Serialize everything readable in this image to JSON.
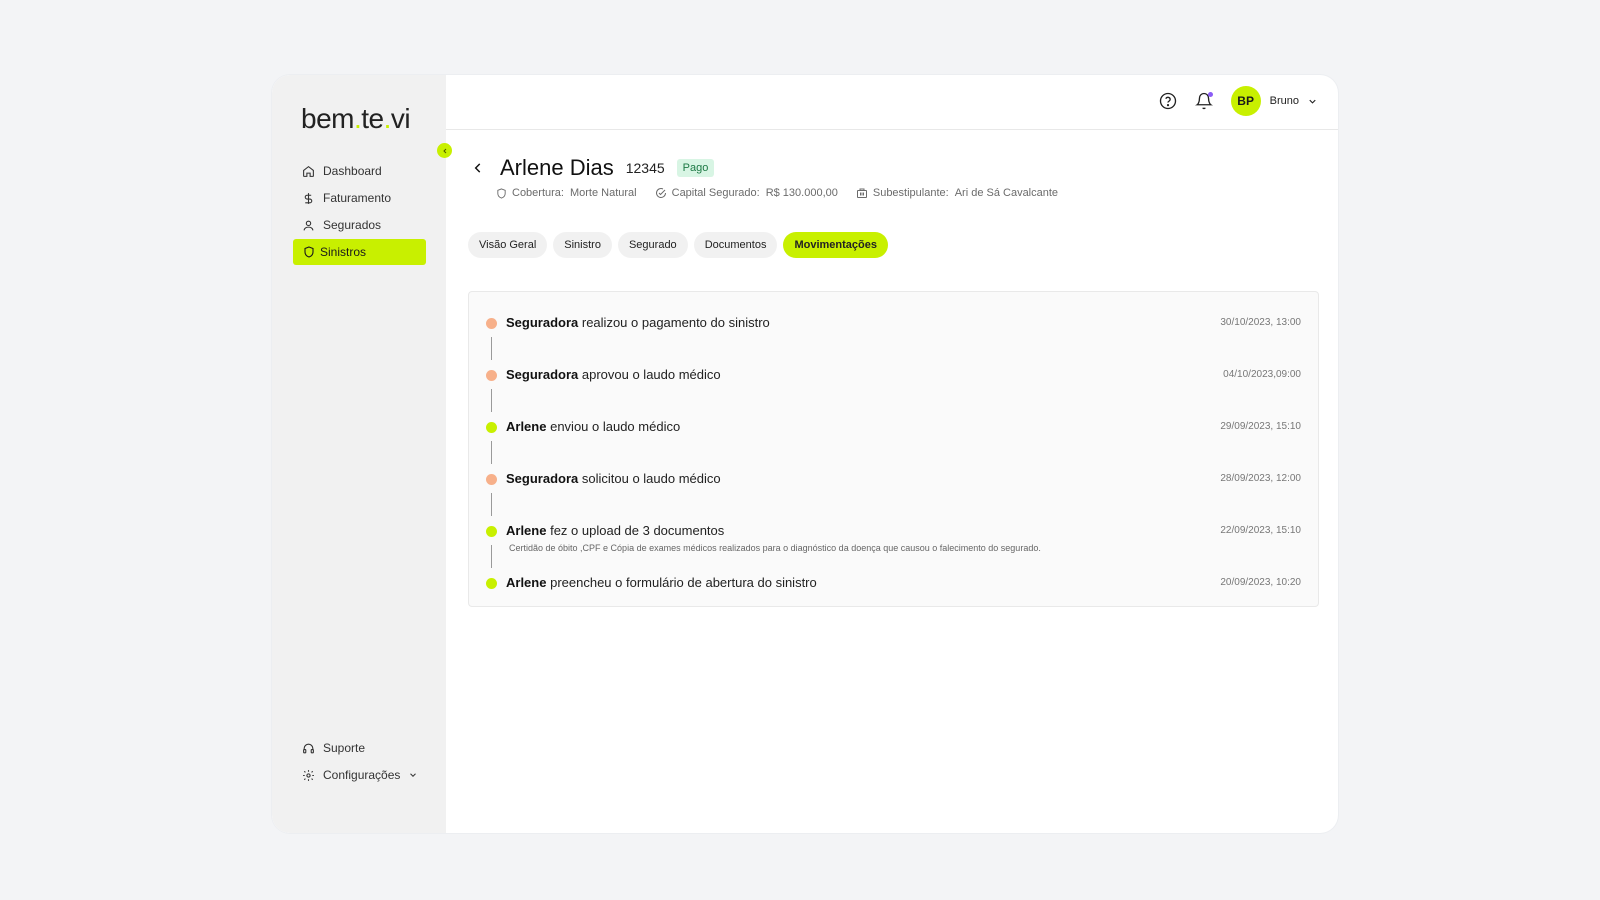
{
  "colors": {
    "accent": "#c8f000",
    "status_insurer": "#f7b08a",
    "status_client": "#c8f000",
    "badge_bg": "#d8f5e4",
    "badge_text": "#1d7a45"
  },
  "sidebar": {
    "logo": {
      "part1": "bem",
      "dot1": ".",
      "part2": "te",
      "dot2": ".",
      "part3": "vi"
    },
    "collapse_icon": "chevron-left-icon",
    "items": [
      {
        "label": "Dashboard",
        "icon": "home-icon",
        "active": false
      },
      {
        "label": "Faturamento",
        "icon": "dollar-icon",
        "active": false
      },
      {
        "label": "Segurados",
        "icon": "user-icon",
        "active": false
      },
      {
        "label": "Sinistros",
        "icon": "shield-icon",
        "active": true
      }
    ],
    "bottom_items": [
      {
        "label": "Suporte",
        "icon": "headset-icon"
      },
      {
        "label": "Configurações",
        "icon": "gear-icon"
      }
    ]
  },
  "header": {
    "help_icon": "help-circle-icon",
    "bell_icon": "bell-icon",
    "avatar_initials": "BP",
    "user_name": "Bruno"
  },
  "claim": {
    "name": "Arlene Dias",
    "id": "12345",
    "status": "Pago",
    "meta": [
      {
        "label": "Cobertura:",
        "value": "Morte Natural",
        "icon": "shield-icon"
      },
      {
        "label": "Capital Segurado:",
        "value": "R$ 130.000,00",
        "icon": "check-circle-icon"
      },
      {
        "label": "Subestipulante:",
        "value": "Ari de Sá Cavalcante",
        "icon": "building-icon"
      }
    ]
  },
  "tabs": [
    {
      "label": "Visão Geral",
      "active": false
    },
    {
      "label": "Sinistro",
      "active": false
    },
    {
      "label": "Segurado",
      "active": false
    },
    {
      "label": "Documentos",
      "active": false
    },
    {
      "label": "Movimentações",
      "active": true
    }
  ],
  "timeline": [
    {
      "actor": "Seguradora",
      "action": "realizou o pagamento do sinistro",
      "time": "30/10/2023, 13:00",
      "type": "insurer",
      "note": ""
    },
    {
      "actor": "Seguradora",
      "action": "aprovou o laudo médico",
      "time": "04/10/2023,09:00",
      "type": "insurer",
      "note": ""
    },
    {
      "actor": "Arlene",
      "action": "enviou o laudo médico",
      "time": "29/09/2023, 15:10",
      "type": "client",
      "note": ""
    },
    {
      "actor": "Seguradora",
      "action": "solicitou o laudo médico",
      "time": "28/09/2023, 12:00",
      "type": "insurer",
      "note": ""
    },
    {
      "actor": "Arlene",
      "action": "fez o upload de 3 documentos",
      "time": "22/09/2023, 15:10",
      "type": "client",
      "note": "Certidão de óbito ,CPF e Cópia de exames médicos realizados para o diagnóstico da doença que causou o falecimento do segurado."
    },
    {
      "actor": "Arlene",
      "action": "preencheu o formulário de abertura do sinistro",
      "time": "20/09/2023, 10:20",
      "type": "client",
      "note": ""
    }
  ]
}
